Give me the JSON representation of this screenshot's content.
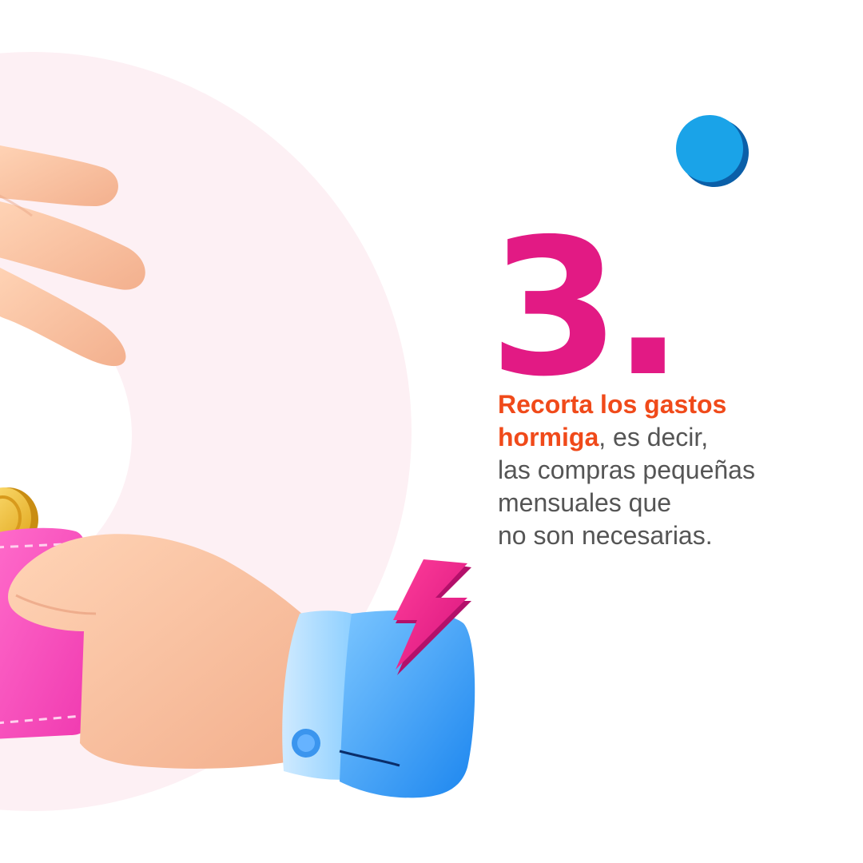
{
  "step": {
    "number": "3."
  },
  "tip": {
    "highlight_line1": "Recorta los gastos",
    "highlight_line2": "hormiga",
    "rest_line2": ", es decir,",
    "line3": "las compras pequeñas",
    "line4": "mensuales que",
    "line5": "no son necesarias."
  },
  "colors": {
    "number": "#e21a84",
    "highlight": "#f04a1a",
    "body_text": "#555555",
    "background_circle": "#fdf0f4",
    "blue_dot": "#1aa3e8",
    "cuff": "#3aa6f5",
    "wallet": "#ff4fbf",
    "lightning": "#e8238f"
  },
  "icons": {
    "decor_dot": "blue-dot-icon",
    "lightning": "lightning-bolt-icon",
    "coin": "gold-coin-icon",
    "wallet": "wallet-icon"
  }
}
